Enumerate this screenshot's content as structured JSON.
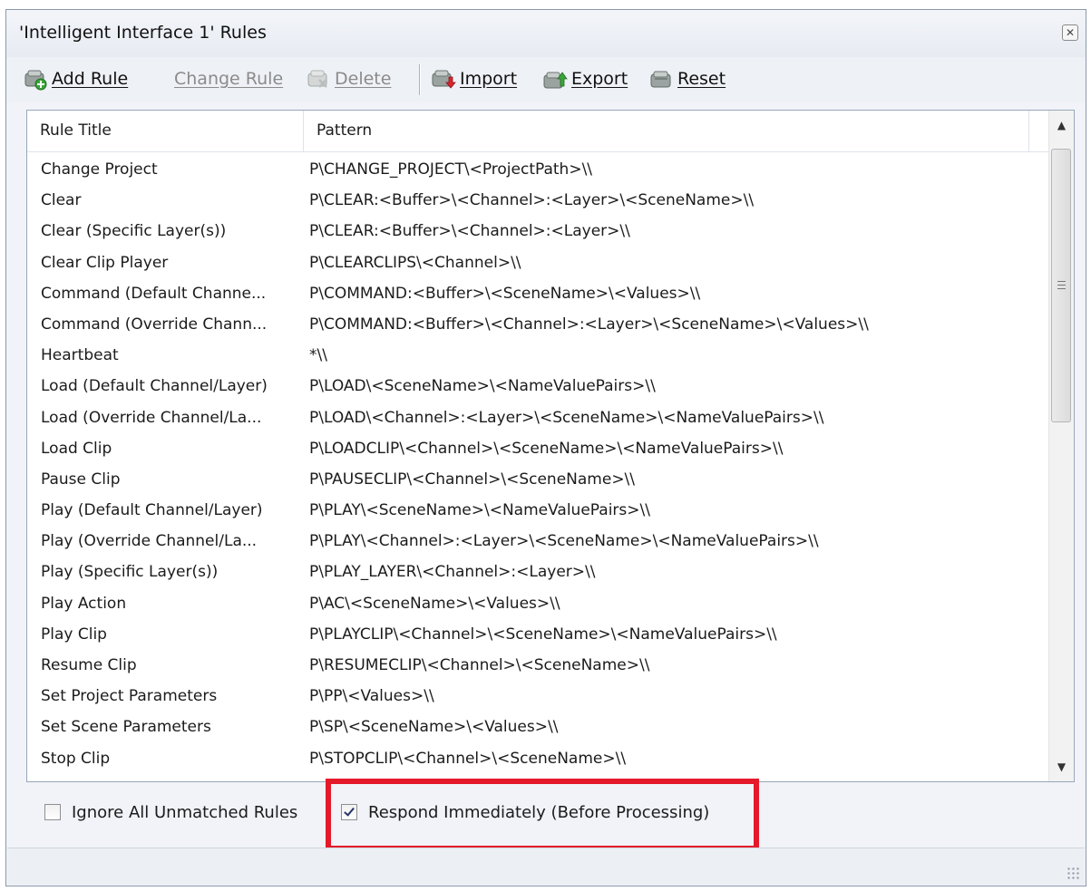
{
  "window": {
    "title": "'Intelligent Interface 1' Rules"
  },
  "toolbar": {
    "add_rule": "Add Rule",
    "change_rule": "Change Rule",
    "delete": "Delete",
    "import": "Import",
    "export": "Export",
    "reset": "Reset"
  },
  "table": {
    "headers": [
      "Rule Title",
      "Pattern"
    ],
    "rows": [
      [
        "Change Project",
        "P\\CHANGE_PROJECT\\<ProjectPath>\\\\"
      ],
      [
        "Clear",
        "P\\CLEAR:<Buffer>\\<Channel>:<Layer>\\<SceneName>\\\\"
      ],
      [
        "Clear (Specific Layer(s))",
        "P\\CLEAR:<Buffer>\\<Channel>:<Layer>\\\\"
      ],
      [
        "Clear Clip Player",
        "P\\CLEARCLIPS\\<Channel>\\\\"
      ],
      [
        "Command (Default Channe...",
        "P\\COMMAND:<Buffer>\\<SceneName>\\<Values>\\\\"
      ],
      [
        "Command (Override Chann...",
        "P\\COMMAND:<Buffer>\\<Channel>:<Layer>\\<SceneName>\\<Values>\\\\"
      ],
      [
        "Heartbeat",
        "*\\\\"
      ],
      [
        "Load (Default Channel/Layer)",
        "P\\LOAD\\<SceneName>\\<NameValuePairs>\\\\"
      ],
      [
        "Load (Override Channel/La...",
        "P\\LOAD\\<Channel>:<Layer>\\<SceneName>\\<NameValuePairs>\\\\"
      ],
      [
        "Load Clip",
        "P\\LOADCLIP\\<Channel>\\<SceneName>\\<NameValuePairs>\\\\"
      ],
      [
        "Pause Clip",
        "P\\PAUSECLIP\\<Channel>\\<SceneName>\\\\"
      ],
      [
        "Play (Default Channel/Layer)",
        "P\\PLAY\\<SceneName>\\<NameValuePairs>\\\\"
      ],
      [
        "Play (Override Channel/La...",
        "P\\PLAY\\<Channel>:<Layer>\\<SceneName>\\<NameValuePairs>\\\\"
      ],
      [
        "Play (Specific Layer(s))",
        "P\\PLAY_LAYER\\<Channel>:<Layer>\\\\"
      ],
      [
        "Play Action",
        "P\\AC\\<SceneName>\\<Values>\\\\"
      ],
      [
        "Play Clip",
        "P\\PLAYCLIP\\<Channel>\\<SceneName>\\<NameValuePairs>\\\\"
      ],
      [
        "Resume Clip",
        "P\\RESUMECLIP\\<Channel>\\<SceneName>\\\\"
      ],
      [
        "Set Project Parameters",
        "P\\PP\\<Values>\\\\"
      ],
      [
        "Set Scene Parameters",
        "P\\SP\\<SceneName>\\<Values>\\\\"
      ],
      [
        "Stop Clip",
        "P\\STOPCLIP\\<Channel>\\<SceneName>\\\\"
      ]
    ]
  },
  "options": {
    "ignore_unmatched": {
      "label": "Ignore All Unmatched Rules",
      "checked": false
    },
    "respond_immediately": {
      "label": "Respond Immediately (Before Processing)",
      "checked": true
    }
  },
  "colors": {
    "highlight": "#e4192a"
  }
}
